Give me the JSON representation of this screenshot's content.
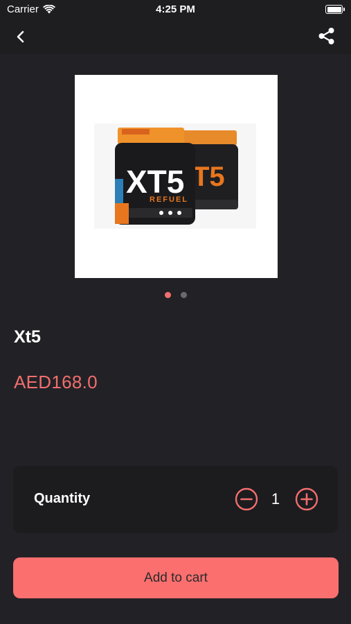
{
  "status_bar": {
    "carrier": "Carrier",
    "time": "4:25 PM"
  },
  "nav": {
    "back_icon": "chevron-left-icon",
    "share_icon": "share-icon"
  },
  "product": {
    "name": "Xt5",
    "price": "AED168.0",
    "image_label": "XT5",
    "image_sublabel": "REFUEL",
    "image_count": 2,
    "active_image_index": 0
  },
  "quantity": {
    "label": "Quantity",
    "value": "1"
  },
  "actions": {
    "add_to_cart_label": "Add to cart"
  },
  "colors": {
    "accent": "#f26e6e",
    "button": "#fb6f6f",
    "background": "#222226",
    "card": "#1c1c1f"
  }
}
